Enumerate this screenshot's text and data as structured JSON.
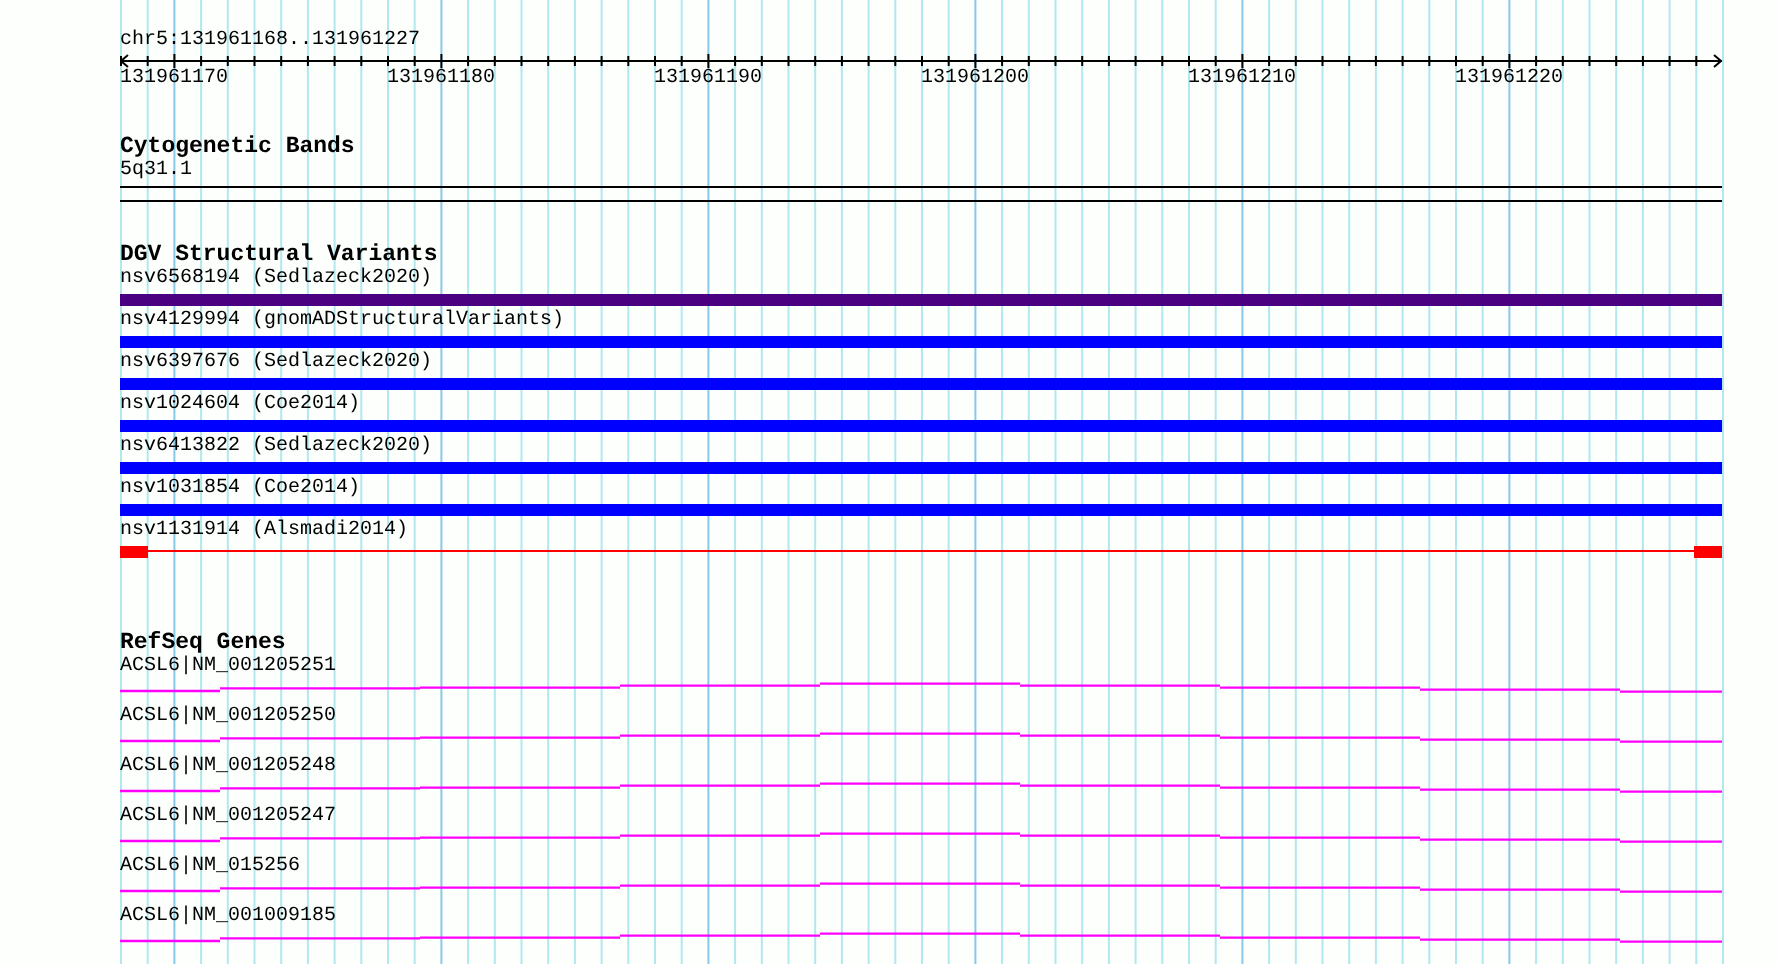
{
  "ruler": {
    "position": "chr5:131961168..131961227",
    "tick_labels": [
      "131961170",
      "131961180",
      "131961190",
      "131961200",
      "131961210",
      "131961220"
    ]
  },
  "tracks": [
    {
      "kind": "cytoband",
      "title": "Cytogenetic Bands",
      "items": [
        {
          "label": "5q31.1"
        }
      ]
    },
    {
      "kind": "variants",
      "title": "DGV Structural Variants",
      "items": [
        {
          "label": "nsv6568194 (Sedlazeck2020)",
          "kind": "bar",
          "color": "#4b0082"
        },
        {
          "label": "nsv4129994 (gnomADStructuralVariants)",
          "kind": "bar",
          "color": "#0000ff"
        },
        {
          "label": "nsv6397676 (Sedlazeck2020)",
          "kind": "bar",
          "color": "#0000ff"
        },
        {
          "label": "nsv1024604 (Coe2014)",
          "kind": "bar",
          "color": "#0000ff"
        },
        {
          "label": "nsv6413822 (Sedlazeck2020)",
          "kind": "bar",
          "color": "#0000ff"
        },
        {
          "label": "nsv1031854 (Coe2014)",
          "kind": "bar",
          "color": "#0000ff"
        },
        {
          "label": "nsv1131914 (Alsmadi2014)",
          "kind": "split",
          "color": "#ff0000"
        }
      ]
    },
    {
      "kind": "genes",
      "title": "RefSeq Genes",
      "items": [
        {
          "label": "ACSL6|NM_001205251"
        },
        {
          "label": "ACSL6|NM_001205250"
        },
        {
          "label": "ACSL6|NM_001205248"
        },
        {
          "label": "ACSL6|NM_001205247"
        },
        {
          "label": "ACSL6|NM_015256"
        },
        {
          "label": "ACSL6|NM_001009185"
        }
      ]
    }
  ]
}
